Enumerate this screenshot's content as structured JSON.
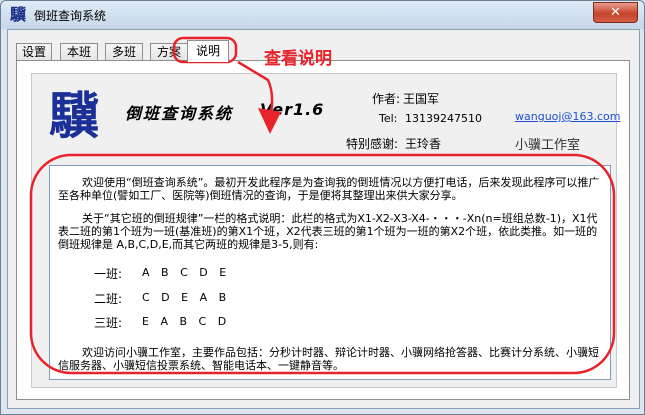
{
  "window": {
    "title": "倒班查询系统",
    "icon_glyph": "驥",
    "icon_name": "app-logo-icon",
    "close_glyph": "✕"
  },
  "tabs": [
    {
      "label": "设置"
    },
    {
      "label": "本班"
    },
    {
      "label": "多班"
    },
    {
      "label": "方案"
    },
    {
      "label": "说明",
      "active": true
    }
  ],
  "about": {
    "logo_glyph": "驥",
    "app_name": "倒班查询系统",
    "version": "Ver1.6",
    "author_label": "作者:",
    "author": "王国军",
    "tel_label": "Tel:",
    "tel": "13139247510",
    "email": "wanguoj@163.com",
    "thanks_label": "特别感谢:",
    "thanks": "王玲香",
    "studio": "小骥工作室"
  },
  "description": {
    "para1": "欢迎使用“倒班查询系统”。最初开发此程序是为查询我的倒班情况以方便打电话，后来发现此程序可以推广至各种单位(譬如工厂、医院等)倒班情况的查询，于是便将其整理出来供大家分享。",
    "para2": "关于“其它班的倒班规律”一栏的格式说明：此栏的格式为X1-X2-X3-X4-・・・-Xn(n=班组总数-1)，X1代表二班的第1个班为一班(基准班)的第X1个班，X2代表三班的第1个班为一班的第X2个班，依此类推。如一班的倒班规律是 A,B,C,D,E,而其它两班的规律是3-5,则有:",
    "rows": [
      {
        "label": "一班:",
        "values": "A B C D E"
      },
      {
        "label": "二班:",
        "values": "C D E A B"
      },
      {
        "label": "三班:",
        "values": "E A B C D"
      }
    ],
    "para3": "欢迎访问小骥工作室，主要作品包括：分秒计时器、辩论计时器、小骥网络抢答器、比赛计分系统、小骥短信服务器、小骥短信投票系统、智能电话本、一键静音等。"
  },
  "annotation": {
    "text": "查看说明",
    "color": "#e8232b"
  }
}
